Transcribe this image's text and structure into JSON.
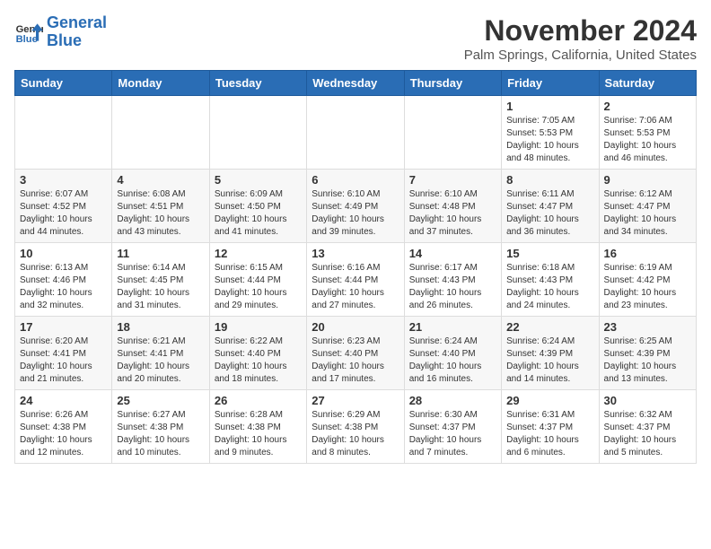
{
  "logo": {
    "general": "General",
    "blue": "Blue"
  },
  "title": "November 2024",
  "subtitle": "Palm Springs, California, United States",
  "header": {
    "days": [
      "Sunday",
      "Monday",
      "Tuesday",
      "Wednesday",
      "Thursday",
      "Friday",
      "Saturday"
    ]
  },
  "weeks": [
    [
      {
        "day": "",
        "info": ""
      },
      {
        "day": "",
        "info": ""
      },
      {
        "day": "",
        "info": ""
      },
      {
        "day": "",
        "info": ""
      },
      {
        "day": "",
        "info": ""
      },
      {
        "day": "1",
        "info": "Sunrise: 7:05 AM\nSunset: 5:53 PM\nDaylight: 10 hours\nand 48 minutes."
      },
      {
        "day": "2",
        "info": "Sunrise: 7:06 AM\nSunset: 5:53 PM\nDaylight: 10 hours\nand 46 minutes."
      }
    ],
    [
      {
        "day": "3",
        "info": "Sunrise: 6:07 AM\nSunset: 4:52 PM\nDaylight: 10 hours\nand 44 minutes."
      },
      {
        "day": "4",
        "info": "Sunrise: 6:08 AM\nSunset: 4:51 PM\nDaylight: 10 hours\nand 43 minutes."
      },
      {
        "day": "5",
        "info": "Sunrise: 6:09 AM\nSunset: 4:50 PM\nDaylight: 10 hours\nand 41 minutes."
      },
      {
        "day": "6",
        "info": "Sunrise: 6:10 AM\nSunset: 4:49 PM\nDaylight: 10 hours\nand 39 minutes."
      },
      {
        "day": "7",
        "info": "Sunrise: 6:10 AM\nSunset: 4:48 PM\nDaylight: 10 hours\nand 37 minutes."
      },
      {
        "day": "8",
        "info": "Sunrise: 6:11 AM\nSunset: 4:47 PM\nDaylight: 10 hours\nand 36 minutes."
      },
      {
        "day": "9",
        "info": "Sunrise: 6:12 AM\nSunset: 4:47 PM\nDaylight: 10 hours\nand 34 minutes."
      }
    ],
    [
      {
        "day": "10",
        "info": "Sunrise: 6:13 AM\nSunset: 4:46 PM\nDaylight: 10 hours\nand 32 minutes."
      },
      {
        "day": "11",
        "info": "Sunrise: 6:14 AM\nSunset: 4:45 PM\nDaylight: 10 hours\nand 31 minutes."
      },
      {
        "day": "12",
        "info": "Sunrise: 6:15 AM\nSunset: 4:44 PM\nDaylight: 10 hours\nand 29 minutes."
      },
      {
        "day": "13",
        "info": "Sunrise: 6:16 AM\nSunset: 4:44 PM\nDaylight: 10 hours\nand 27 minutes."
      },
      {
        "day": "14",
        "info": "Sunrise: 6:17 AM\nSunset: 4:43 PM\nDaylight: 10 hours\nand 26 minutes."
      },
      {
        "day": "15",
        "info": "Sunrise: 6:18 AM\nSunset: 4:43 PM\nDaylight: 10 hours\nand 24 minutes."
      },
      {
        "day": "16",
        "info": "Sunrise: 6:19 AM\nSunset: 4:42 PM\nDaylight: 10 hours\nand 23 minutes."
      }
    ],
    [
      {
        "day": "17",
        "info": "Sunrise: 6:20 AM\nSunset: 4:41 PM\nDaylight: 10 hours\nand 21 minutes."
      },
      {
        "day": "18",
        "info": "Sunrise: 6:21 AM\nSunset: 4:41 PM\nDaylight: 10 hours\nand 20 minutes."
      },
      {
        "day": "19",
        "info": "Sunrise: 6:22 AM\nSunset: 4:40 PM\nDaylight: 10 hours\nand 18 minutes."
      },
      {
        "day": "20",
        "info": "Sunrise: 6:23 AM\nSunset: 4:40 PM\nDaylight: 10 hours\nand 17 minutes."
      },
      {
        "day": "21",
        "info": "Sunrise: 6:24 AM\nSunset: 4:40 PM\nDaylight: 10 hours\nand 16 minutes."
      },
      {
        "day": "22",
        "info": "Sunrise: 6:24 AM\nSunset: 4:39 PM\nDaylight: 10 hours\nand 14 minutes."
      },
      {
        "day": "23",
        "info": "Sunrise: 6:25 AM\nSunset: 4:39 PM\nDaylight: 10 hours\nand 13 minutes."
      }
    ],
    [
      {
        "day": "24",
        "info": "Sunrise: 6:26 AM\nSunset: 4:38 PM\nDaylight: 10 hours\nand 12 minutes."
      },
      {
        "day": "25",
        "info": "Sunrise: 6:27 AM\nSunset: 4:38 PM\nDaylight: 10 hours\nand 10 minutes."
      },
      {
        "day": "26",
        "info": "Sunrise: 6:28 AM\nSunset: 4:38 PM\nDaylight: 10 hours\nand 9 minutes."
      },
      {
        "day": "27",
        "info": "Sunrise: 6:29 AM\nSunset: 4:38 PM\nDaylight: 10 hours\nand 8 minutes."
      },
      {
        "day": "28",
        "info": "Sunrise: 6:30 AM\nSunset: 4:37 PM\nDaylight: 10 hours\nand 7 minutes."
      },
      {
        "day": "29",
        "info": "Sunrise: 6:31 AM\nSunset: 4:37 PM\nDaylight: 10 hours\nand 6 minutes."
      },
      {
        "day": "30",
        "info": "Sunrise: 6:32 AM\nSunset: 4:37 PM\nDaylight: 10 hours\nand 5 minutes."
      }
    ]
  ]
}
